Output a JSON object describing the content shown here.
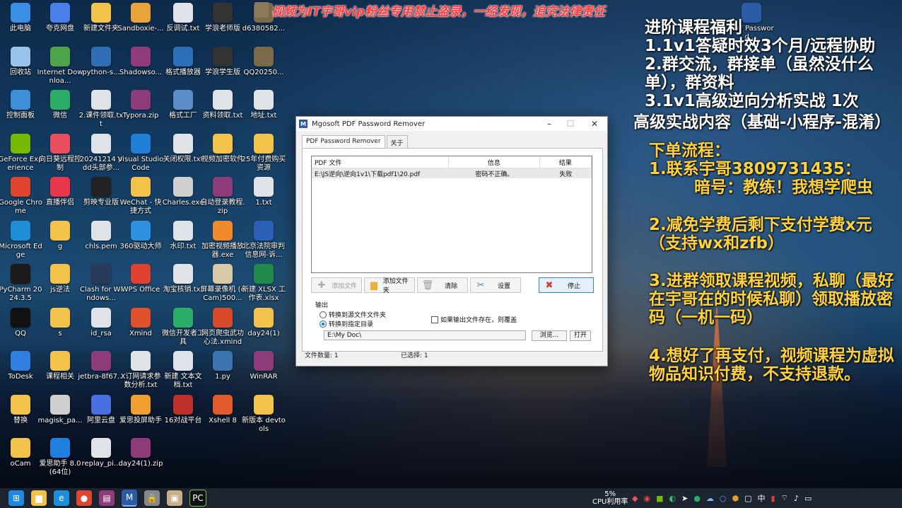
{
  "banner": "视频为IT宇哥vip粉丝专用禁止盗录，一经发现，追究法律责任",
  "desktop_icons": [
    {
      "label": "此电脑",
      "icon": "computer-icon",
      "color": "#3a8ee6"
    },
    {
      "label": "夸克网盘",
      "icon": "cloud-drive-icon",
      "color": "#4a7fe8"
    },
    {
      "label": "新建文件夹",
      "icon": "folder-icon",
      "color": "#f3c24b"
    },
    {
      "label": "Sandboxie-...",
      "icon": "sandbox-icon",
      "color": "#e8a33a"
    },
    {
      "label": "反调试.txt",
      "icon": "text-file-icon",
      "color": "#dfe3e8"
    },
    {
      "label": "学浪老师版",
      "icon": "app-icon",
      "color": "#333"
    },
    {
      "label": "d6380582...",
      "icon": "image-icon",
      "color": "#7a6a4a"
    },
    {
      "label": "回收站",
      "icon": "recycle-bin-icon",
      "color": "#9ac3ec"
    },
    {
      "label": "Internet Downloa...",
      "icon": "download-manager-icon",
      "color": "#4fa34a"
    },
    {
      "label": "python-s...",
      "icon": "python-icon",
      "color": "#2f6db5"
    },
    {
      "label": "Shadowso...",
      "icon": "archive-icon",
      "color": "#8e3b7a"
    },
    {
      "label": "格式播放器",
      "icon": "player-icon",
      "color": "#2a6fb8"
    },
    {
      "label": "学浪学生版",
      "icon": "app-icon",
      "color": "#333"
    },
    {
      "label": "QQ20250...",
      "icon": "image-icon",
      "color": "#7a6a4a"
    },
    {
      "label": "控制面板",
      "icon": "control-panel-icon",
      "color": "#3d8fd8"
    },
    {
      "label": "微信",
      "icon": "wechat-icon",
      "color": "#2aae67"
    },
    {
      "label": "2.课件领取.txt",
      "icon": "text-file-icon",
      "color": "#dfe3e8"
    },
    {
      "label": "Typora.zip",
      "icon": "archive-icon",
      "color": "#8e3b7a"
    },
    {
      "label": "格式工厂",
      "icon": "format-factory-icon",
      "color": "#5b8ec9"
    },
    {
      "label": "资料领取.txt",
      "icon": "text-file-icon",
      "color": "#dfe3e8"
    },
    {
      "label": "地址.txt",
      "icon": "text-file-icon",
      "color": "#dfe3e8"
    },
    {
      "label": "GeForce Experience",
      "icon": "nvidia-icon",
      "color": "#76b900"
    },
    {
      "label": "向日葵远程控制",
      "icon": "sunflower-icon",
      "color": "#e84e5e"
    },
    {
      "label": "20241214 pdd头部参...",
      "icon": "text-file-icon",
      "color": "#dfe3e8"
    },
    {
      "label": "Visual Studio Code",
      "icon": "vscode-icon",
      "color": "#1f7fd6"
    },
    {
      "label": "关闭权限.txt",
      "icon": "text-file-icon",
      "color": "#dfe3e8"
    },
    {
      "label": "视频加密软件",
      "icon": "folder-icon",
      "color": "#f3c24b"
    },
    {
      "label": "25年付费购买资源",
      "icon": "folder-icon",
      "color": "#f3c24b"
    },
    {
      "label": "Google Chrome",
      "icon": "chrome-icon",
      "color": "#e0452f"
    },
    {
      "label": "直播伴侣",
      "icon": "live-icon",
      "color": "#e8364a"
    },
    {
      "label": "剪映专业版",
      "icon": "capcut-icon",
      "color": "#222"
    },
    {
      "label": "WeChat - 快捷方式",
      "icon": "folder-icon",
      "color": "#f3c24b"
    },
    {
      "label": "Charles.exe",
      "icon": "charles-icon",
      "color": "#cfcfcf"
    },
    {
      "label": "自动登录教程.zip",
      "icon": "archive-icon",
      "color": "#8e3b7a"
    },
    {
      "label": "1.txt",
      "icon": "text-file-icon",
      "color": "#dfe3e8"
    },
    {
      "label": "Microsoft Edge",
      "icon": "edge-icon",
      "color": "#1e8fd6"
    },
    {
      "label": "g",
      "icon": "folder-icon",
      "color": "#f3c24b"
    },
    {
      "label": "chls.pem",
      "icon": "file-icon",
      "color": "#dfe3e8"
    },
    {
      "label": "360驱动大师",
      "icon": "driver-icon",
      "color": "#2f8fe0"
    },
    {
      "label": "水印.txt",
      "icon": "text-file-icon",
      "color": "#dfe3e8"
    },
    {
      "label": "加密视频播放器.exe",
      "icon": "player-icon",
      "color": "#f08a2a"
    },
    {
      "label": "北京法院审判信息网-诉...",
      "icon": "word-icon",
      "color": "#2b5fb8"
    },
    {
      "label": "PyCharm 2024.3.5",
      "icon": "pycharm-icon",
      "color": "#1a1a1a"
    },
    {
      "label": "js逆法",
      "icon": "folder-icon",
      "color": "#f3c24b"
    },
    {
      "label": "Clash for Windows...",
      "icon": "clash-icon",
      "color": "#2a3a5a"
    },
    {
      "label": "WPS Office",
      "icon": "wps-icon",
      "color": "#e0402f"
    },
    {
      "label": "淘宝核销.txt",
      "icon": "text-file-icon",
      "color": "#dfe3e8"
    },
    {
      "label": "屏幕录像机 (oCam)500...",
      "icon": "image-icon",
      "color": "#d8c8a8"
    },
    {
      "label": "新建 XLSX 工作表.xlsx",
      "icon": "excel-icon",
      "color": "#1f8a4a"
    },
    {
      "label": "QQ",
      "icon": "qq-icon",
      "color": "#111"
    },
    {
      "label": "s",
      "icon": "folder-icon",
      "color": "#f3c24b"
    },
    {
      "label": "id_rsa",
      "icon": "file-icon",
      "color": "#dfe3e8"
    },
    {
      "label": "Xmind",
      "icon": "xmind-icon",
      "color": "#e0502a"
    },
    {
      "label": "微信开发者工具",
      "icon": "wechat-dev-icon",
      "color": "#2aae67"
    },
    {
      "label": "网页爬虫武功心法.xmind",
      "icon": "xmind-icon",
      "color": "#d84a2a"
    },
    {
      "label": "day24(1)",
      "icon": "folder-icon",
      "color": "#f3c24b"
    },
    {
      "label": "ToDesk",
      "icon": "todesk-icon",
      "color": "#2f7fe0"
    },
    {
      "label": "课程相关",
      "icon": "folder-icon",
      "color": "#f3c24b"
    },
    {
      "label": "jetbra-8f67...",
      "icon": "archive-icon",
      "color": "#8e3b7a"
    },
    {
      "label": "X订网请求参数分析.txt",
      "icon": "text-file-icon",
      "color": "#dfe3e8"
    },
    {
      "label": "新建 文本文档.txt",
      "icon": "text-file-icon",
      "color": "#dfe3e8"
    },
    {
      "label": "1.py",
      "icon": "python-file-icon",
      "color": "#3b74b0"
    },
    {
      "label": "WinRAR",
      "icon": "winrar-icon",
      "color": "#8e3b7a"
    },
    {
      "label": "替换",
      "icon": "folder-icon",
      "color": "#f3c24b"
    },
    {
      "label": "magisk_pa...",
      "icon": "image-icon",
      "color": "#cfcfcf"
    },
    {
      "label": "阿里云盘",
      "icon": "aliyun-drive-icon",
      "color": "#4a6fe0"
    },
    {
      "label": "爱思投屏助手",
      "icon": "mirror-icon",
      "color": "#f0a030"
    },
    {
      "label": "16对战平台",
      "icon": "game-icon",
      "color": "#c0302a"
    },
    {
      "label": "Xshell 8",
      "icon": "xshell-icon",
      "color": "#e05a2a"
    },
    {
      "label": "新版本 devtools",
      "icon": "folder-icon",
      "color": "#f3c24b"
    },
    {
      "label": "oCam",
      "icon": "folder-icon",
      "color": "#f3c24b"
    },
    {
      "label": "爱思助手 8.0(64位)",
      "icon": "aisi-icon",
      "color": "#1e7fe0"
    },
    {
      "label": "replay_pi...",
      "icon": "file-icon",
      "color": "#dfe3e8"
    },
    {
      "label": "day24(1).zip",
      "icon": "archive-icon",
      "color": "#8e3b7a"
    },
    {
      "label": "PDF Password ...",
      "icon": "pdf-remover-icon",
      "color": "#2b5aa6"
    }
  ],
  "right_panel": {
    "title": "进阶课程福利",
    "benefits": [
      "1.1v1答疑时效3个月/远程协助",
      "2.群交流，群接单（虽然没什么单），群资料",
      "3.1v1高级逆向分析实战 1次"
    ],
    "advanced": "高级实战内容（基础-小程序-混淆）",
    "order_title": "下单流程：",
    "steps": [
      "1.联系宇哥3809731435：",
      "暗号：教练！我想学爬虫",
      "2.减免学费后剩下支付学费x元（支持wx和zfb）",
      "3.进群领取课程视频，私聊（最好在宇哥在的时候私聊）领取播放密码（一机一码）",
      "4.想好了再支付，视频课程为虚拟物品知识付费，不支持退款。"
    ]
  },
  "window": {
    "title": "Mgosoft PDF Password Remover",
    "tabs": [
      "PDF Password Remover",
      "关于"
    ],
    "columns": [
      "PDF 文件",
      "信息",
      "结果"
    ],
    "rows": [
      {
        "file": "E:\\JS逆向\\逆向1v1\\下载pdf1\\20.pdf",
        "info": "密码不正确。",
        "result": "失败"
      }
    ],
    "buttons": {
      "add_file": "添加文件",
      "add_folder": "添加文件夹",
      "clear": "清除",
      "settings": "设置",
      "stop": "停止"
    },
    "output": {
      "label": "输出",
      "radio_source": "转换到源文件文件夹",
      "radio_dir": "转换到指定目录",
      "overwrite": "如果输出文件存在，则覆盖",
      "path": "E:\\My Doc\\",
      "browse": "浏览...",
      "open": "打开"
    },
    "status": {
      "count": "文件数量: 1",
      "selected": "已选择: 1"
    }
  },
  "taskbar": {
    "cpu_pct": "5%",
    "cpu_label": "CPU利用率",
    "ime": "中"
  }
}
